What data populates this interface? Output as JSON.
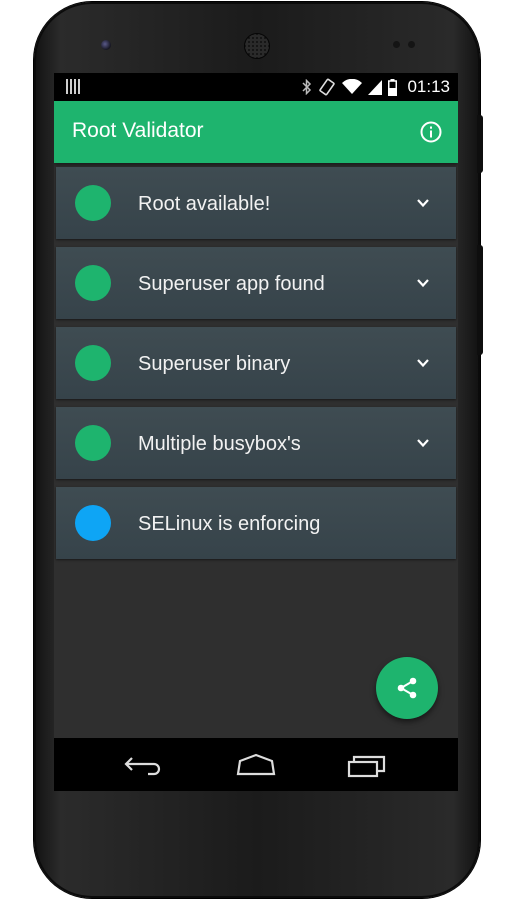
{
  "status_bar": {
    "time": "01:13",
    "icons": [
      "notification-icon",
      "bluetooth-icon",
      "rotate-icon",
      "wifi-icon",
      "signal-icon",
      "battery-icon"
    ]
  },
  "app_bar": {
    "title": "Root Validator",
    "action_icon": "info-icon",
    "color": "#1eb46e"
  },
  "checks": [
    {
      "label": "Root available!",
      "status_color": "#1eb46e",
      "expandable": true
    },
    {
      "label": "Superuser app found",
      "status_color": "#1eb46e",
      "expandable": true
    },
    {
      "label": "Superuser binary",
      "status_color": "#1eb46e",
      "expandable": true
    },
    {
      "label": "Multiple busybox's",
      "status_color": "#1eb46e",
      "expandable": true
    },
    {
      "label": "SELinux is enforcing",
      "status_color": "#0ea5f5",
      "expandable": false
    }
  ],
  "fab": {
    "icon": "share-icon",
    "color": "#1eb46e"
  },
  "nav_bar": {
    "icons": [
      "back-icon",
      "home-icon",
      "recents-icon"
    ]
  }
}
